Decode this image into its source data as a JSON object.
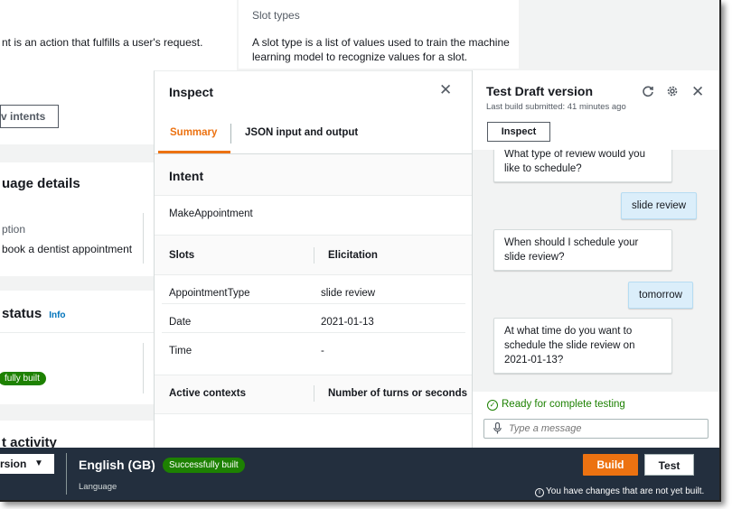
{
  "background": {
    "intent_desc": "nt is an action that fulfills a user's request.",
    "slot_types_title": "Slot types",
    "slot_types_desc_1": "A slot type is a list of values used to train the machine",
    "slot_types_desc_2": "learning model to recognize values for a slot.",
    "view_intents_btn": "v intents",
    "language_details_title": "uage details",
    "description_label": "ption",
    "description_value": "book a dentist appointment",
    "status_title": "status",
    "status_info": "Info",
    "fully_built_badge": "fully built",
    "activity_title": "t activity"
  },
  "inspect": {
    "title": "Inspect",
    "tabs": [
      {
        "label": "Summary",
        "active": true
      },
      {
        "label": "JSON input and output",
        "active": false
      }
    ],
    "intent_heading": "Intent",
    "intent_value": "MakeAppointment",
    "slots_header": {
      "col1": "Slots",
      "col2": "Elicitation"
    },
    "slots": [
      {
        "name": "AppointmentType",
        "value": "slide review"
      },
      {
        "name": "Date",
        "value": "2021-01-13"
      },
      {
        "name": "Time",
        "value": "-"
      }
    ],
    "contexts_header": {
      "col1": "Active contexts",
      "col2": "Number of turns or seconds"
    }
  },
  "test_panel": {
    "title": "Test Draft version",
    "subtitle": "Last build submitted: 41 minutes ago",
    "inspect_button": "Inspect",
    "messages": [
      {
        "from": "bot",
        "text": "What type of review would you like to schedule?"
      },
      {
        "from": "user",
        "text": "slide review"
      },
      {
        "from": "bot",
        "text": "When should I schedule your slide review?"
      },
      {
        "from": "user",
        "text": "tomorrow"
      },
      {
        "from": "bot",
        "text": "At what time do you want to schedule the slide review on 2021-01-13?"
      }
    ],
    "ready_text": "Ready for complete testing",
    "message_placeholder": "Type a message"
  },
  "bottom_bar": {
    "version_label": "rsion",
    "language": "English (GB)",
    "language_sub": "Language",
    "built_badge": "Successfully built",
    "build_button": "Build",
    "test_button": "Test",
    "changes_text": "You have changes that are not yet built."
  },
  "colors": {
    "accent_orange": "#ec7211",
    "success_green": "#1d8102",
    "user_bubble": "#dbeefa",
    "bottom_bar": "#232f3e"
  }
}
